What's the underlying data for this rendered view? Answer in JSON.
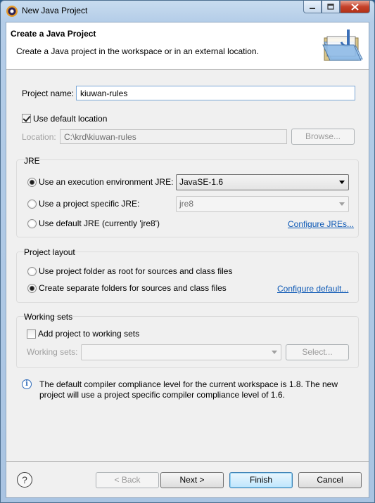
{
  "window": {
    "title": "New Java Project"
  },
  "header": {
    "title": "Create a Java Project",
    "description": "Create a Java project in the workspace or in an external location."
  },
  "project": {
    "name_label": "Project name:",
    "name_value": "kiuwan-rules",
    "use_default_location_label": "Use default location",
    "use_default_location_checked": true,
    "location_label": "Location:",
    "location_value": "C:\\krd\\kiuwan-rules",
    "browse_label": "Browse..."
  },
  "jre": {
    "group_title": "JRE",
    "exec_env_label": "Use an execution environment JRE:",
    "exec_env_value": "JavaSE-1.6",
    "project_specific_label": "Use a project specific JRE:",
    "project_specific_value": "jre8",
    "default_jre_label": "Use default JRE (currently 'jre8')",
    "configure_jres_link": "Configure JREs...",
    "selected": "exec_env"
  },
  "layout": {
    "group_title": "Project layout",
    "root_option_label": "Use project folder as root for sources and class files",
    "separate_option_label": "Create separate folders for sources and class files",
    "configure_default_link": "Configure default...",
    "selected": "separate"
  },
  "working_sets": {
    "group_title": "Working sets",
    "add_label": "Add project to working sets",
    "add_checked": false,
    "sets_label": "Working sets:",
    "sets_value": "",
    "select_label": "Select..."
  },
  "info": {
    "message": "The default compiler compliance level for the current workspace is 1.8. The new project will use a project specific compiler compliance level of 1.6."
  },
  "footer": {
    "help_glyph": "?",
    "back_label": "< Back",
    "next_label": "Next >",
    "finish_label": "Finish",
    "cancel_label": "Cancel"
  },
  "colors": {
    "link": "#0c58b5",
    "title_bar": "#b4cde8",
    "close_button": "#c5412a"
  },
  "icons": [
    "eclipse-app-icon",
    "minimize-icon",
    "maximize-icon",
    "close-icon",
    "new-java-project-wizard-icon",
    "info-icon",
    "help-icon",
    "dropdown-arrow-icon"
  ]
}
